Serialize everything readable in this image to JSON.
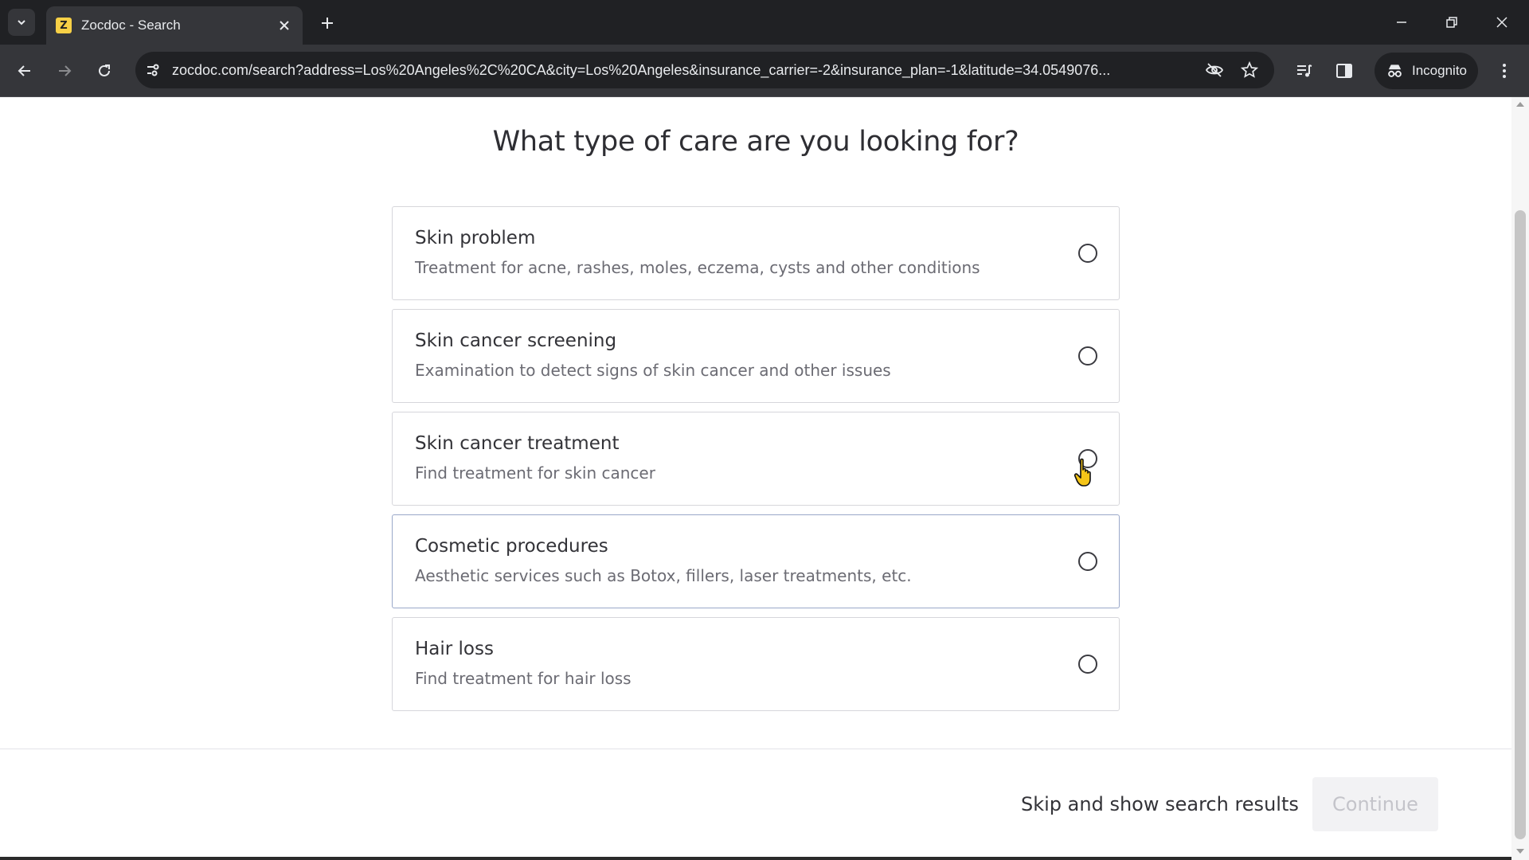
{
  "browser": {
    "tab": {
      "favicon_letter": "Z",
      "title": "Zocdoc - Search"
    },
    "url": "zocdoc.com/search?address=Los%20Angeles%2C%20CA&city=Los%20Angeles&insurance_carrier=-2&insurance_plan=-1&latitude=34.0549076...",
    "incognito_label": "Incognito"
  },
  "page": {
    "heading": "What type of care are you looking for?",
    "options": [
      {
        "title": "Skin problem",
        "description": "Treatment for acne, rashes, moles, eczema, cysts and other conditions"
      },
      {
        "title": "Skin cancer screening",
        "description": "Examination to detect signs of skin cancer and other issues"
      },
      {
        "title": "Skin cancer treatment",
        "description": "Find treatment for skin cancer"
      },
      {
        "title": "Cosmetic procedures",
        "description": "Aesthetic services such as Botox, fillers, laser treatments, etc."
      },
      {
        "title": "Hair loss",
        "description": "Find treatment for hair loss"
      }
    ],
    "skip_label": "Skip and show search results",
    "continue_label": "Continue"
  }
}
